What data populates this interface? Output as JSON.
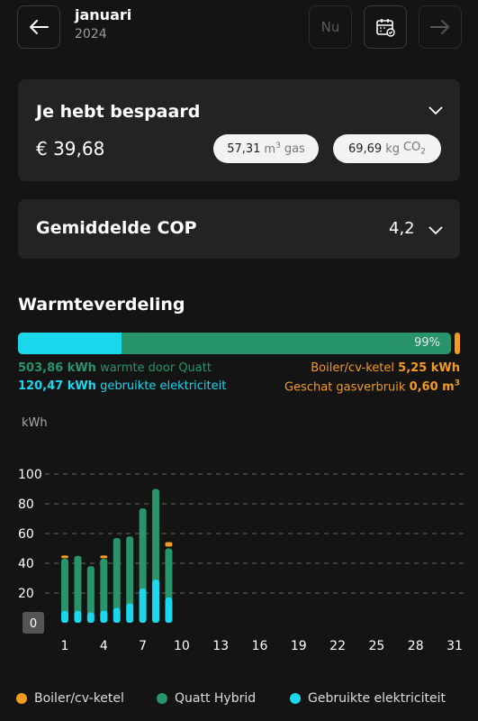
{
  "header": {
    "month": "januari",
    "year": "2024",
    "now_label": "Nu"
  },
  "savings_card": {
    "title": "Je hebt bespaard",
    "amount": "€ 39,68",
    "gas_value": "57,31",
    "gas_unit_base": "m",
    "gas_unit_sup": "3",
    "gas_label": "gas",
    "co2_value": "69,69",
    "co2_unit": "kg",
    "co2_label_base": "CO",
    "co2_label_sub": "2"
  },
  "cop_card": {
    "title": "Gemiddelde COP",
    "value": "4,2"
  },
  "heat": {
    "title": "Warmteverdeling",
    "percent_label": "99%",
    "electric_fraction": 0.24,
    "quatt_fraction": 0.99,
    "quatt_kwh": "503,86 kWh",
    "quatt_text": "warmte door Quatt",
    "electric_kwh": "120,47 kWh",
    "electric_text": "gebruikte elektriciteit",
    "boiler_text": "Boiler/cv-ketel",
    "boiler_kwh": "5,25 kWh",
    "gas_text": "Geschat gasverbruik",
    "gas_value": "0,60 m",
    "gas_sup": "3"
  },
  "colors": {
    "quatt": "#27946a",
    "electric": "#1ad7ec",
    "boiler": "#f49a1e"
  },
  "chart_data": {
    "type": "bar",
    "ylabel": "kWh",
    "ylim": [
      0,
      100
    ],
    "yticks": [
      "0",
      "20",
      "40",
      "60",
      "80",
      "100"
    ],
    "xticks": [
      "1",
      "4",
      "7",
      "10",
      "13",
      "16",
      "19",
      "22",
      "25",
      "28",
      "31"
    ],
    "days": [
      1,
      2,
      3,
      4,
      5,
      6,
      7,
      8,
      9
    ],
    "series": [
      {
        "name": "Gebruikte elektriciteit",
        "values": [
          8,
          8,
          7,
          8,
          10,
          13,
          23,
          29,
          17
        ]
      },
      {
        "name": "Quatt Hybrid",
        "values": [
          35,
          37,
          31,
          35,
          47,
          45,
          54,
          61,
          33
        ]
      },
      {
        "name": "Boiler/cv-ketel",
        "values": [
          1,
          0,
          0,
          1,
          0,
          0,
          0,
          0,
          3
        ]
      }
    ]
  },
  "legend": [
    "Boiler/cv-ketel",
    "Quatt Hybrid",
    "Gebruikte elektriciteit"
  ]
}
